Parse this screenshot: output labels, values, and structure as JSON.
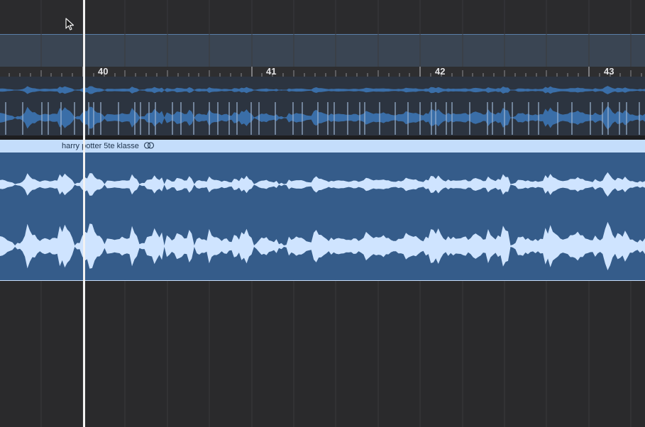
{
  "ruler": {
    "bars": [
      {
        "label": "40"
      },
      {
        "label": "41"
      },
      {
        "label": "42"
      },
      {
        "label": "43"
      }
    ]
  },
  "region": {
    "name": "harry potter 5te klasse",
    "loop_icon": "loop-rings-icon",
    "color": "#355c8a",
    "header_color": "#c4ddfb",
    "waveform_color": "#cfe4ff"
  },
  "overview": {
    "waveform_color": "#3a6ea8",
    "background": "#2c3440"
  },
  "playhead": {
    "color": "#f2f2f2"
  },
  "cursor": {
    "icon": "arrow-pointer-icon"
  }
}
